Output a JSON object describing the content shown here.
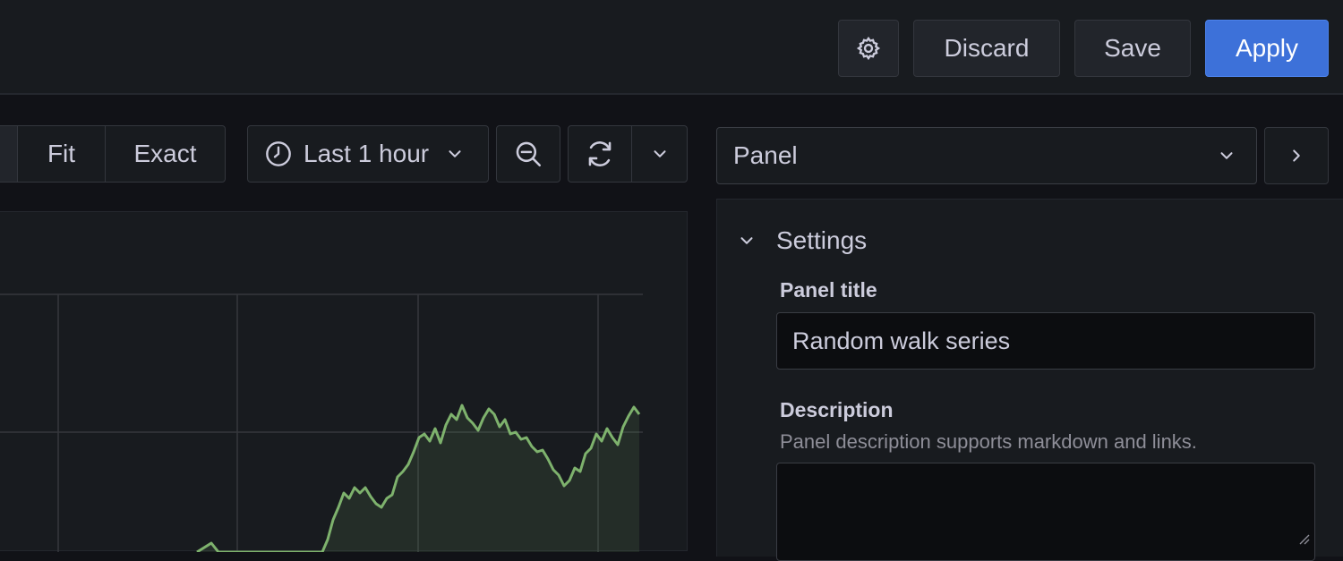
{
  "header": {
    "discard_label": "Discard",
    "save_label": "Save",
    "apply_label": "Apply"
  },
  "toolbar": {
    "zoom_fit_label": "Fit",
    "zoom_exact_label": "Exact",
    "time_range_label": "Last 1 hour"
  },
  "options": {
    "pane_select_value": "Panel",
    "section_title": "Settings",
    "panel_title_label": "Panel title",
    "panel_title_value": "Random walk series",
    "description_label": "Description",
    "description_help": "Panel description supports markdown and links.",
    "description_value": ""
  },
  "colors": {
    "accent": "#3d71d9",
    "series": "#7eb26d",
    "background": "#111217",
    "panel": "#181b1f"
  }
}
